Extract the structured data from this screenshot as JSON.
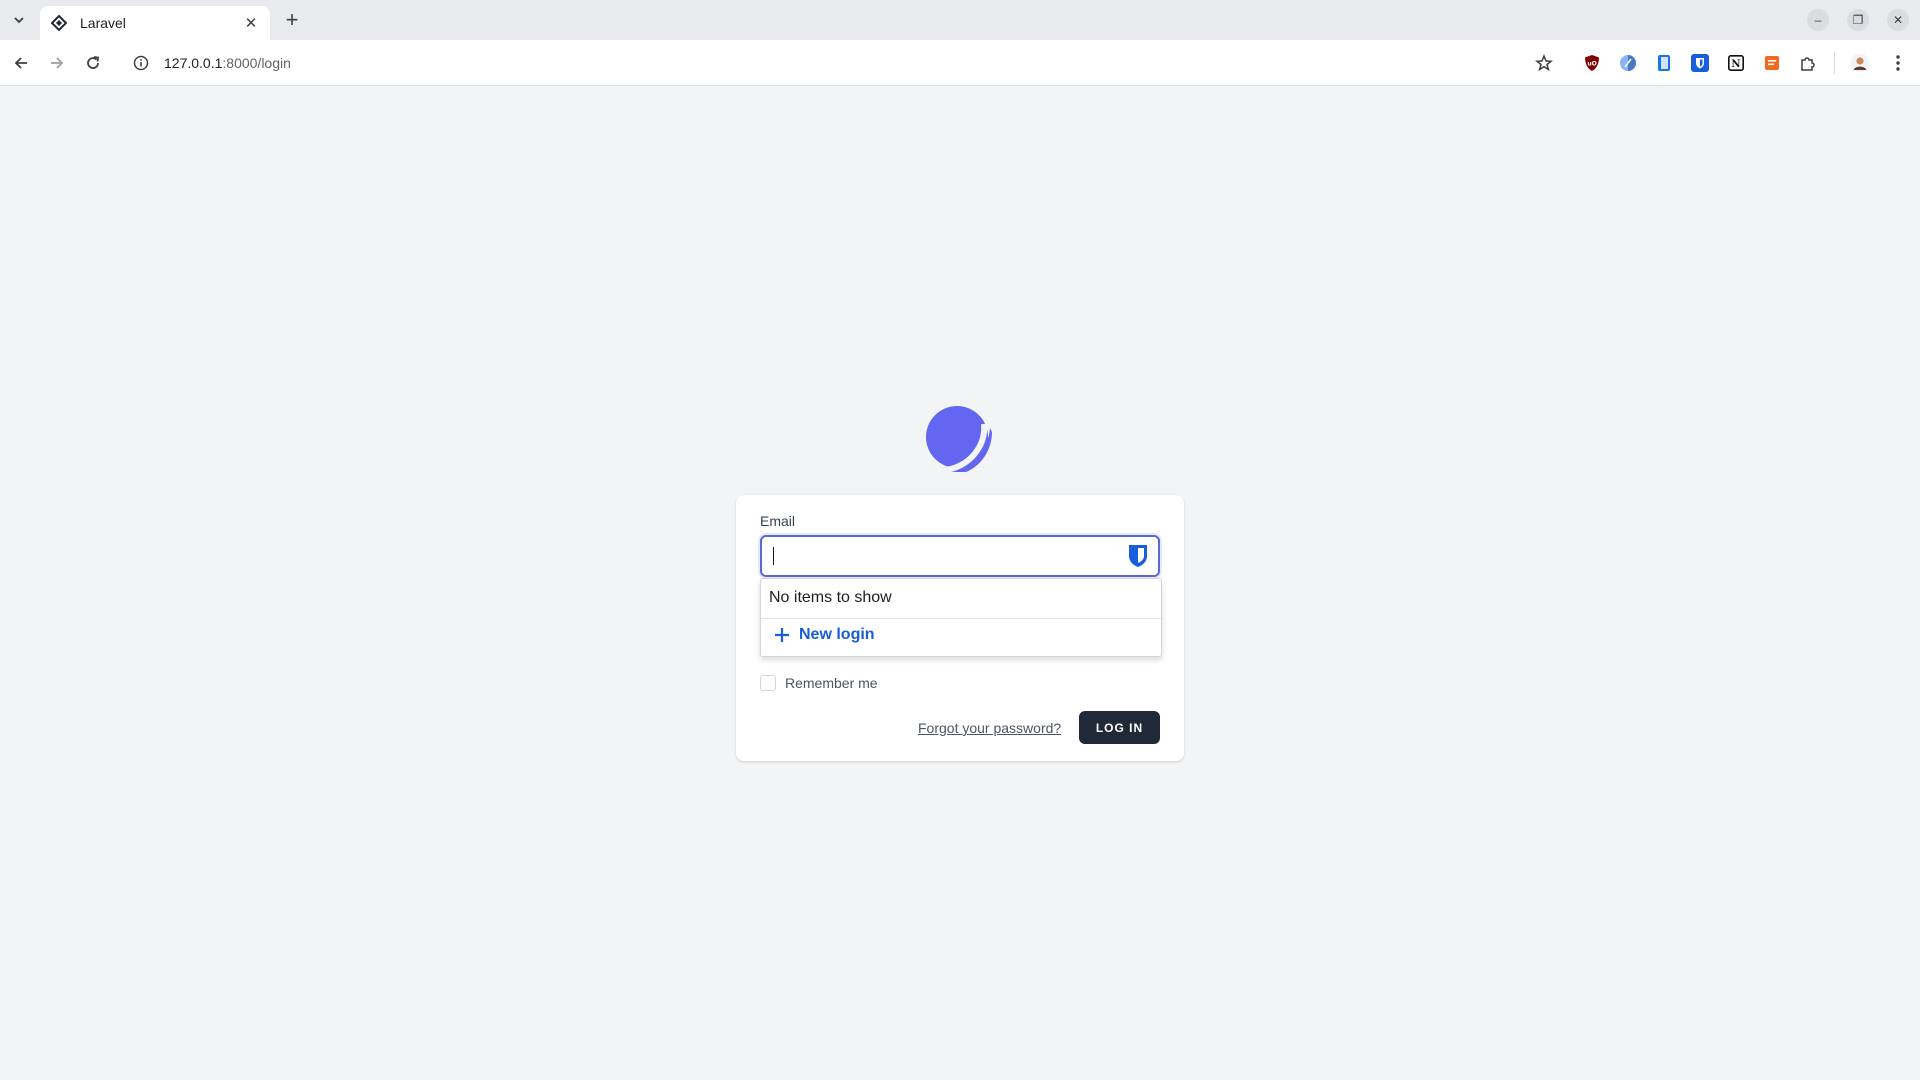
{
  "browser": {
    "tab": {
      "title": "Laravel"
    },
    "address": {
      "host": "127.0.0.1",
      "rest": ":8000/login"
    },
    "extensions": [
      {
        "icon": "ublock-icon",
        "text": "uO",
        "color": "#800000"
      },
      {
        "icon": "privacy-extension-icon",
        "text": "",
        "color": "#4a90d9"
      },
      {
        "icon": "reader-extension-icon",
        "text": "",
        "color": "#1a73e8"
      },
      {
        "icon": "bitwarden-extension-icon",
        "text": "",
        "color": "#175ddc"
      },
      {
        "icon": "notion-extension-icon",
        "text": "N",
        "color": "#111111"
      },
      {
        "icon": "orange-extension-icon",
        "text": "",
        "color": "#f26a21"
      }
    ]
  },
  "login": {
    "email_label": "Email",
    "email_value": "",
    "remember_label": "Remember me",
    "forgot_label": "Forgot your password?",
    "login_button": "LOG IN"
  },
  "bitwarden_menu": {
    "empty_text": "No items to show",
    "new_login_label": "New login"
  },
  "colors": {
    "accent": "#6366f1",
    "button": "#1f2937",
    "bitwarden": "#175ddc"
  }
}
